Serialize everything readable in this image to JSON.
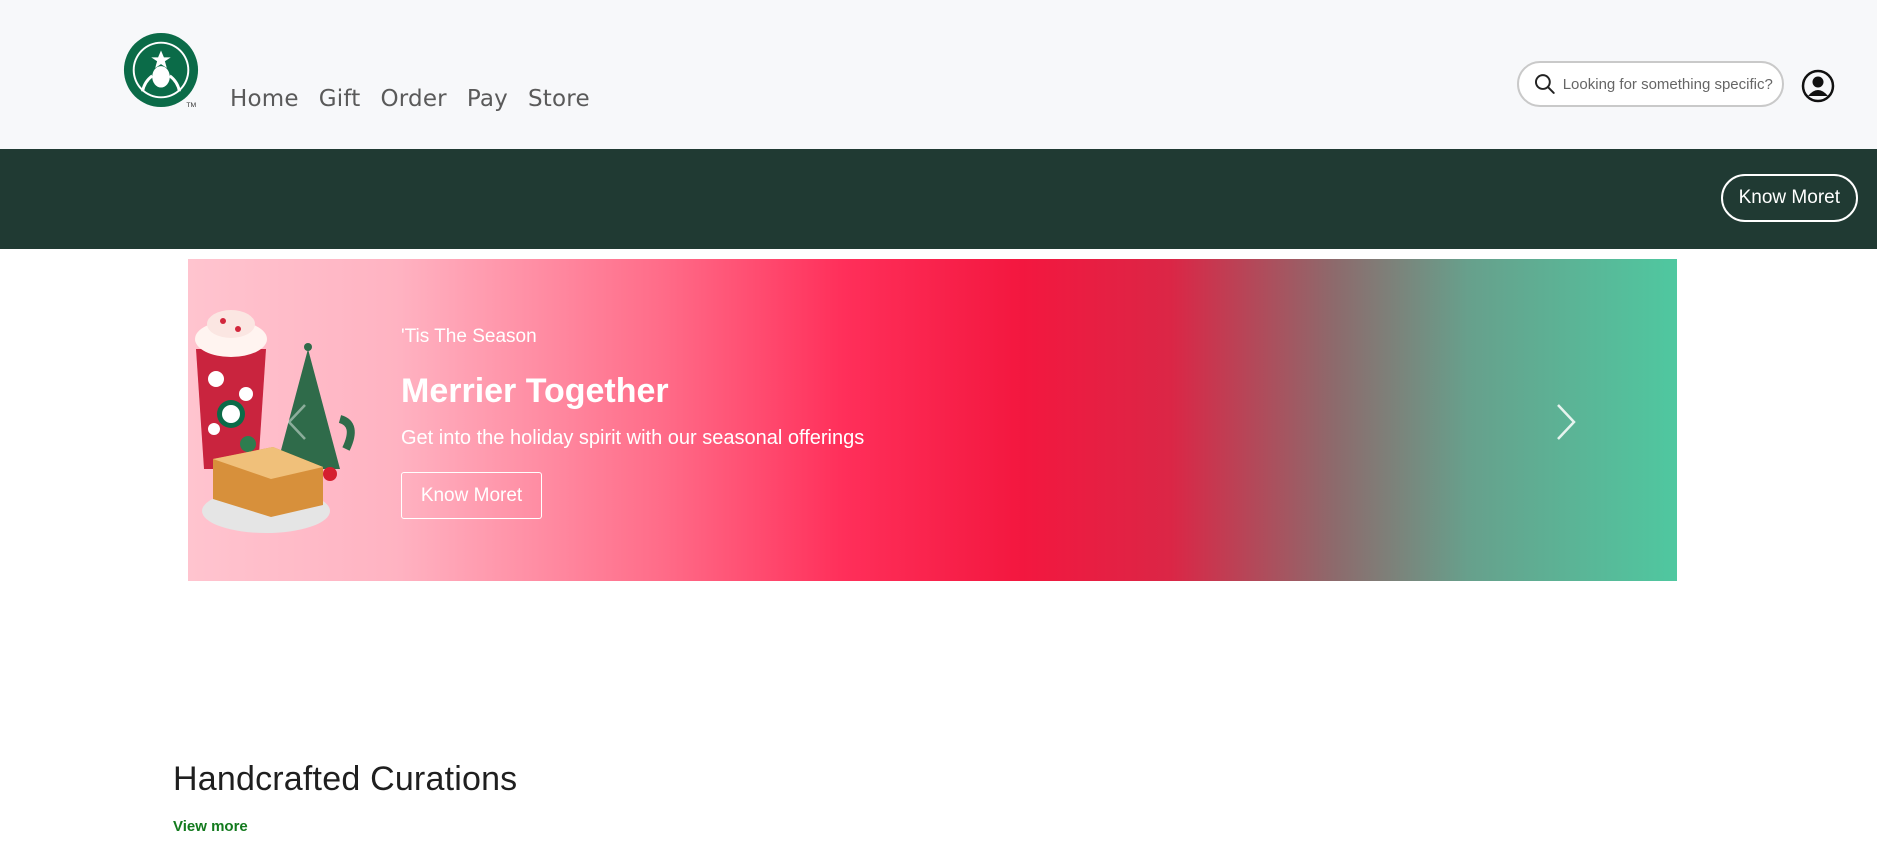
{
  "navbar": {
    "logo_icon": "starbucks-siren-logo",
    "links": [
      "Home",
      "Gift",
      "Order",
      "Pay",
      "Store"
    ],
    "search": {
      "placeholder": "Looking for something specific?",
      "value": "",
      "icon": "search-icon"
    },
    "account_icon": "user-circle-icon"
  },
  "promo_band": {
    "button_label": "Know Moret",
    "background": "#203a33"
  },
  "hero": {
    "eyebrow": "'Tis The Season",
    "title": "Merrier Together",
    "description": "Get into the holiday spirit with our seasonal offerings",
    "button_label": "Know Moret",
    "prev_icon": "chevron-left-icon",
    "next_icon": "chevron-right-icon",
    "gradient_colors": [
      "#ffc4cf",
      "#ff2f5a",
      "#f3173f",
      "#4fc8a0"
    ]
  },
  "section": {
    "title": "Handcrafted Curations",
    "view_more": "View more",
    "link_color": "#137a1e"
  }
}
